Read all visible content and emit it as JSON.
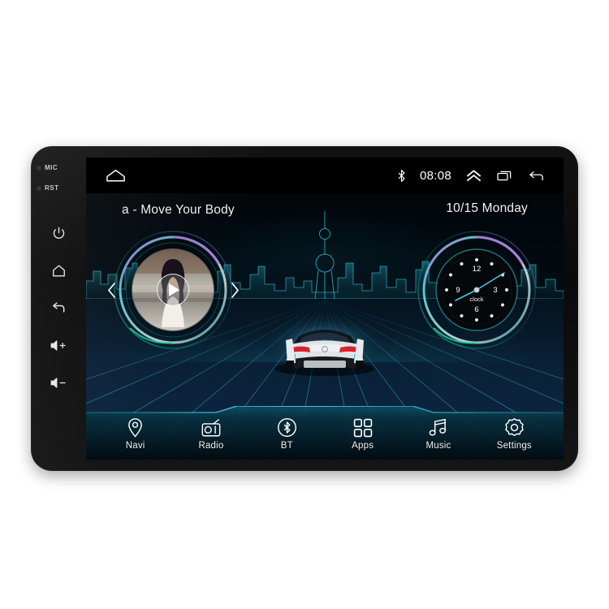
{
  "device": {
    "left_panel": {
      "indicators": [
        {
          "label": "MIC",
          "name": "mic-indicator"
        },
        {
          "label": "RST",
          "name": "rst-indicator"
        }
      ],
      "buttons": [
        {
          "icon": "power-icon",
          "name": "power-button"
        },
        {
          "icon": "home-icon",
          "name": "home-button"
        },
        {
          "icon": "back-icon",
          "name": "back-button"
        },
        {
          "icon": "volume-up-icon",
          "name": "volume-up-button"
        },
        {
          "icon": "volume-down-icon",
          "name": "volume-down-button"
        }
      ]
    }
  },
  "statusbar": {
    "home_icon": "home-icon",
    "bluetooth_icon": "bluetooth-icon",
    "time": "08:08",
    "expand_icon": "chevron-double-up-icon",
    "recents_icon": "recent-apps-icon",
    "back_icon": "back-arrow-icon"
  },
  "home": {
    "song_title": "a - Move Your Body",
    "date": "10/15 Monday",
    "music_widget": {
      "prev_label": "‹",
      "next_label": "›",
      "play_icon": "play-icon",
      "album_art": "album-art-portrait"
    },
    "clock_widget": {
      "brand": "clock",
      "numerals": [
        "12",
        "3",
        "6",
        "9"
      ],
      "hour_angle": 245,
      "minute_angle": 55
    },
    "wallpaper": {
      "car": "sports-car-rear",
      "skyline": "city-skyline",
      "grid": "perspective-grid"
    }
  },
  "dock": {
    "items": [
      {
        "label": "Navi",
        "icon": "location-pin-icon"
      },
      {
        "label": "Radio",
        "icon": "radio-icon"
      },
      {
        "label": "BT",
        "icon": "bluetooth-circle-icon"
      },
      {
        "label": "Apps",
        "icon": "grid-apps-icon"
      },
      {
        "label": "Music",
        "icon": "music-note-icon"
      },
      {
        "label": "Settings",
        "icon": "gear-icon"
      }
    ]
  },
  "colors": {
    "accent_teal": "#2fd4c8",
    "accent_purple": "#9b6bd8",
    "screen_bg": "#01060a",
    "bezel": "#101010",
    "text": "#f2f2f2"
  }
}
